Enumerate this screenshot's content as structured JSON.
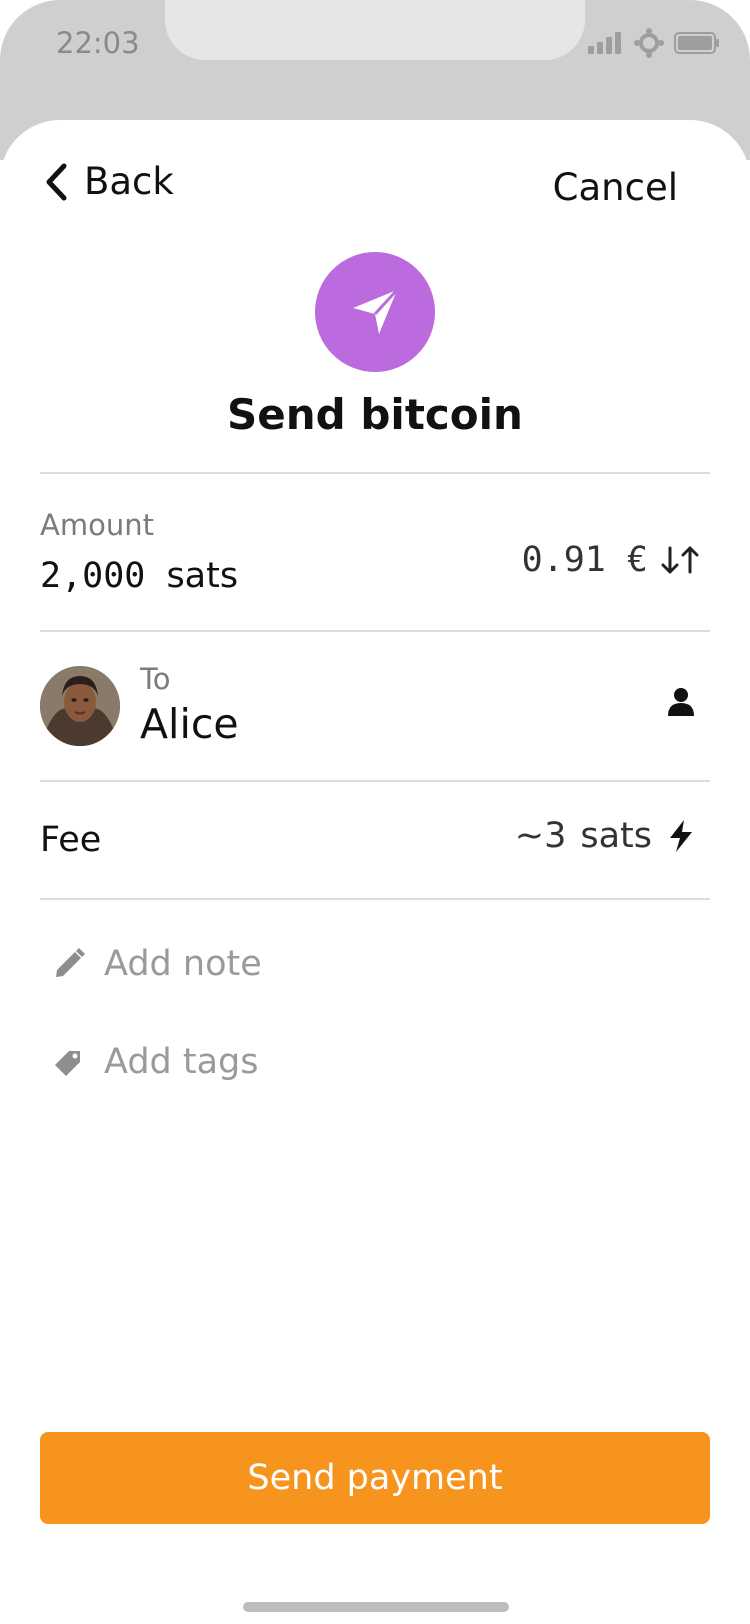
{
  "status_bar": {
    "time": "22:03",
    "icons": [
      "signal-icon",
      "location-icon",
      "battery-icon"
    ]
  },
  "nav": {
    "back_label": "Back",
    "cancel_label": "Cancel"
  },
  "hero": {
    "icon": "send-icon",
    "title": "Send bitcoin"
  },
  "amount": {
    "label": "Amount",
    "value": "2,000",
    "unit": "sats",
    "fiat_value": "0.91 €",
    "swap_icon": "swap-arrows-icon"
  },
  "recipient": {
    "label": "To",
    "name": "Alice",
    "contact_icon": "person-icon"
  },
  "fee": {
    "label": "Fee",
    "value": "~3",
    "unit": "sats",
    "icon": "lightning-icon"
  },
  "actions": {
    "add_note": "Add note",
    "add_tags": "Add tags"
  },
  "primary_button": {
    "label": "Send payment"
  },
  "colors": {
    "accent_orange": "#f7941d",
    "hero_purple": "#bb6bdd",
    "muted_text": "#9a9a9a"
  }
}
